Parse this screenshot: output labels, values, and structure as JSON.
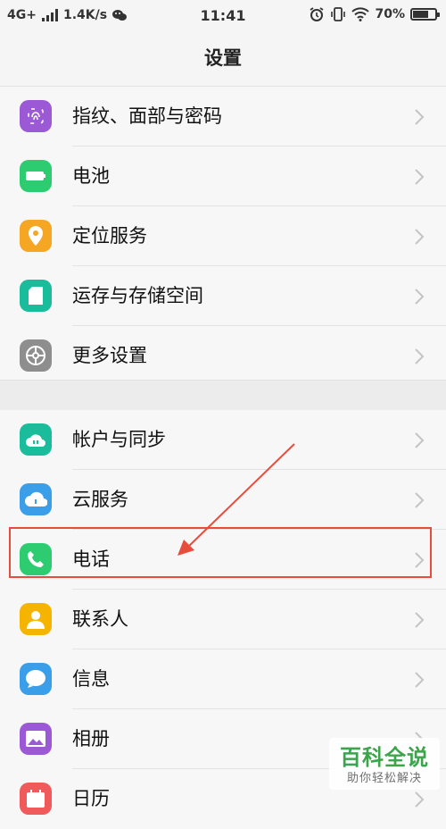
{
  "status": {
    "network": "4G+",
    "speed": "1.4K/s",
    "time": "11:41",
    "battery": "70%",
    "battery_level": 0.7,
    "icons": [
      "signal-icon",
      "wechat-icon",
      "alarm-icon",
      "vibrate-icon",
      "wifi-icon",
      "battery-icon"
    ]
  },
  "header": {
    "title": "设置"
  },
  "group1": [
    {
      "label": "指纹、面部与密码",
      "icon": "fingerprint-icon",
      "color": "#9b59d6"
    },
    {
      "label": "电池",
      "icon": "battery-icon",
      "color": "#2ecc71"
    },
    {
      "label": "定位服务",
      "icon": "location-icon",
      "color": "#f5a623"
    },
    {
      "label": "运存与存储空间",
      "icon": "storage-icon",
      "color": "#1abc9c"
    },
    {
      "label": "更多设置",
      "icon": "gear-icon",
      "color": "#8e8e8e"
    }
  ],
  "group2": [
    {
      "label": "帐户与同步",
      "icon": "sync-icon",
      "color": "#1abc9c"
    },
    {
      "label": "云服务",
      "icon": "cloud-icon",
      "color": "#3a9ee8"
    },
    {
      "label": "电话",
      "icon": "phone-icon",
      "color": "#2ecc71"
    },
    {
      "label": "联系人",
      "icon": "contacts-icon",
      "color": "#f5b400"
    },
    {
      "label": "信息",
      "icon": "message-icon",
      "color": "#3a9ee8"
    },
    {
      "label": "相册",
      "icon": "gallery-icon",
      "color": "#9b59d6"
    },
    {
      "label": "日历",
      "icon": "calendar-icon",
      "color": "#f05a5a"
    }
  ],
  "watermark": {
    "title": "百科全说",
    "subtitle": "助你轻松解决"
  },
  "annotation": {
    "color": "#e74c3c"
  }
}
